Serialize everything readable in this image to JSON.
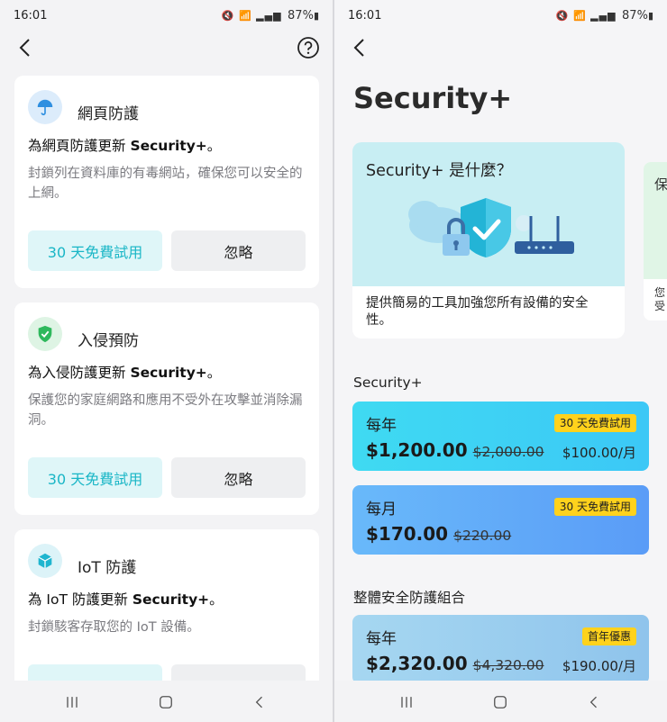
{
  "status": {
    "time": "16:01",
    "battery": "87%"
  },
  "left": {
    "cards": [
      {
        "title": "網頁防護",
        "headline_prefix": "為網頁防護更新 ",
        "headline_product": "Security+",
        "headline_suffix": "。",
        "description": "封鎖列在資料庫的有毒網站，確保您可以安全的上網。",
        "trial_label": "30 天免費試用",
        "ignore_label": "忽略",
        "icon": "umbrella-icon",
        "icon_bg": "#dcecfb",
        "icon_color": "#2f8fe0"
      },
      {
        "title": "入侵預防",
        "headline_prefix": "為入侵防護更新 ",
        "headline_product": "Security+",
        "headline_suffix": "。",
        "description": "保護您的家庭網路和應用不受外在攻擊並消除漏洞。",
        "trial_label": "30 天免費試用",
        "ignore_label": "忽略",
        "icon": "shield-check-icon",
        "icon_bg": "#def4e4",
        "icon_color": "#2eb85c"
      },
      {
        "title": "IoT 防護",
        "headline_prefix": "為 IoT 防護更新 ",
        "headline_product": "Security+",
        "headline_suffix": "。",
        "description": "封鎖駭客存取您的 IoT 設備。",
        "icon": "cube-icon",
        "icon_bg": "#dcf3f8",
        "icon_color": "#1fb5cf"
      }
    ]
  },
  "right": {
    "page_title": "Security+",
    "info_card": {
      "question": "Security+ 是什麼？",
      "description": "提供簡易的工具加強您所有設備的安全性。"
    },
    "peek_card": {
      "title_fragment": "保",
      "desc_fragment": "您\n受"
    },
    "section1_label": "Security+",
    "section2_label": "整體安全防護組合",
    "plans": [
      {
        "period": "每年",
        "badge": "30 天免費試用",
        "price": "$1,200.00",
        "old_price": "$2,000.00",
        "per_month": "$100.00/月",
        "bg": "linear-gradient(90deg,#3fdaf2,#3cc8f6)"
      },
      {
        "period": "每月",
        "badge": "30 天免費試用",
        "price": "$170.00",
        "old_price": "$220.00",
        "per_month": "",
        "bg": "linear-gradient(90deg,#69b9fa,#5a9cf7)"
      },
      {
        "period": "每年",
        "badge": "首年優惠",
        "price": "$2,320.00",
        "old_price": "$4,320.00",
        "per_month": "$190.00/月",
        "bg": "linear-gradient(90deg,#a6d7f1,#8fc4ec)"
      }
    ]
  }
}
